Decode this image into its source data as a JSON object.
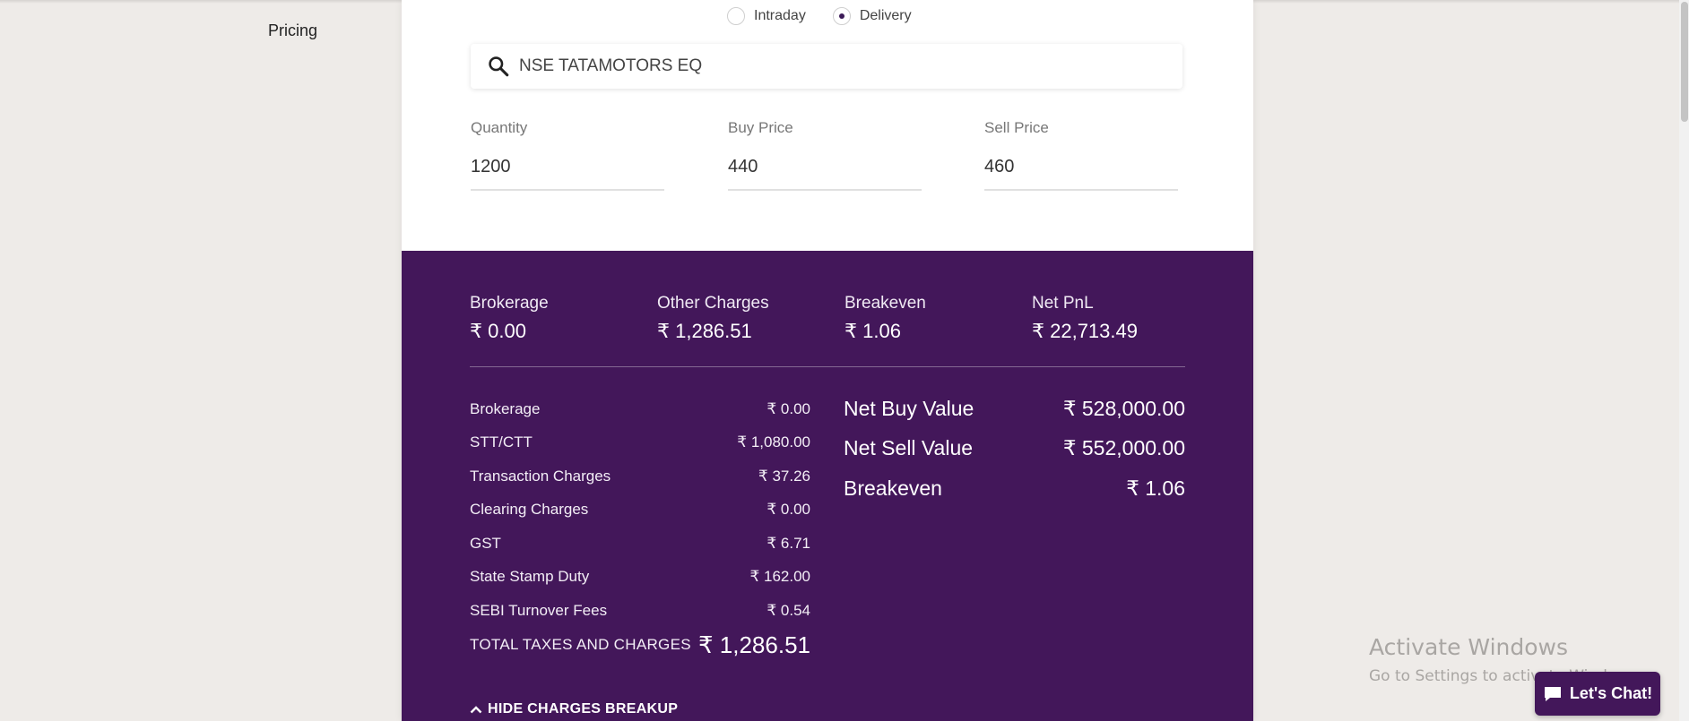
{
  "sidebar": {
    "pricing_label": "Pricing"
  },
  "trade_type": {
    "options": [
      {
        "label": "Intraday",
        "checked": false
      },
      {
        "label": "Delivery",
        "checked": true
      }
    ]
  },
  "search": {
    "value": "NSE TATAMOTORS EQ",
    "icon": "search-icon"
  },
  "inputs": {
    "quantity": {
      "label": "Quantity",
      "value": "1200"
    },
    "buy_price": {
      "label": "Buy Price",
      "value": "440"
    },
    "sell_price": {
      "label": "Sell Price",
      "value": "460"
    }
  },
  "summary": {
    "brokerage": {
      "label": "Brokerage",
      "value": "₹ 0.00"
    },
    "other_charges": {
      "label": "Other Charges",
      "value": "₹ 1,286.51"
    },
    "breakeven": {
      "label": "Breakeven",
      "value": "₹ 1.06"
    },
    "net_pnl": {
      "label": "Net PnL",
      "value": "₹ 22,713.49"
    }
  },
  "breakup": [
    {
      "label": "Brokerage",
      "value": "₹ 0.00"
    },
    {
      "label": "STT/CTT",
      "value": "₹ 1,080.00"
    },
    {
      "label": "Transaction Charges",
      "value": "₹ 37.26"
    },
    {
      "label": "Clearing Charges",
      "value": "₹ 0.00"
    },
    {
      "label": "GST",
      "value": "₹ 6.71"
    },
    {
      "label": "State Stamp Duty",
      "value": "₹ 162.00"
    },
    {
      "label": "SEBI Turnover Fees",
      "value": "₹ 0.54"
    }
  ],
  "total": {
    "label": "TOTAL TAXES AND CHARGES",
    "value": "₹ 1,286.51"
  },
  "net": [
    {
      "label": "Net Buy Value",
      "value": "₹ 528,000.00"
    },
    {
      "label": "Net Sell Value",
      "value": "₹ 552,000.00"
    },
    {
      "label": "Breakeven",
      "value": "₹ 1.06"
    }
  ],
  "toggle": {
    "label": "HIDE CHARGES BREAKUP",
    "icon": "chevron-up-icon"
  },
  "watermark": {
    "title": "Activate Windows",
    "subtitle": "Go to Settings to activate Windows."
  },
  "chat": {
    "label": "Let's Chat!",
    "icon": "chat-bubble-icon"
  },
  "colors": {
    "panel": "#43175a",
    "background": "#eeebe8",
    "card": "#ffffff"
  }
}
